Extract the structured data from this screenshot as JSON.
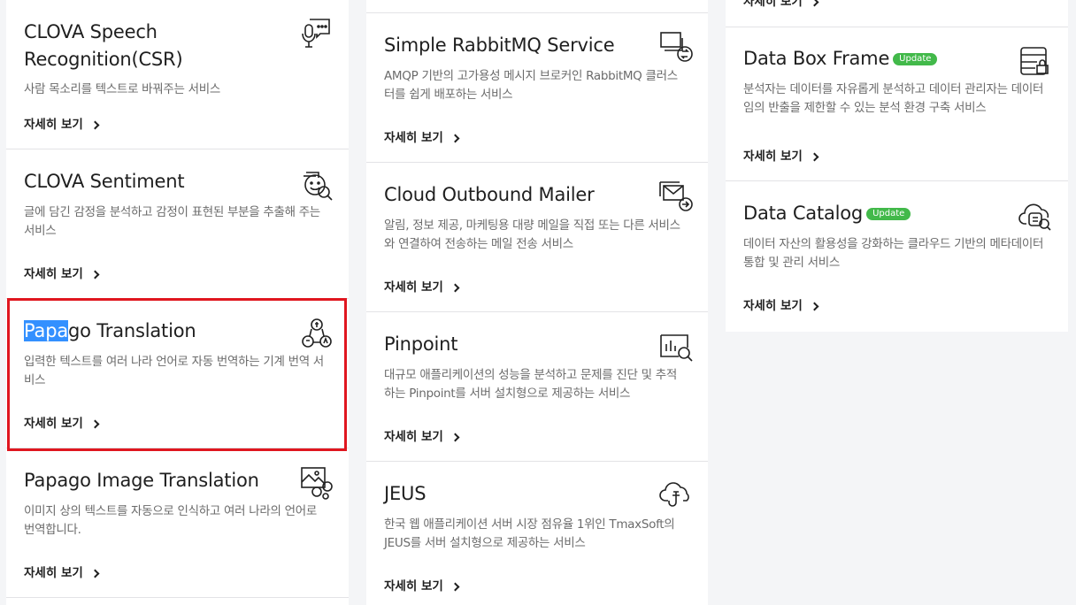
{
  "more_label": "자세히 보기",
  "badge_label": "Update",
  "col1": [
    {
      "title_lines": [
        "CLOVA Speech",
        "Recognition(CSR)"
      ],
      "desc": "사람 목소리를 텍스트로 바꿔주는 서비스",
      "icon": "speech-bubble-mic-icon"
    },
    {
      "title": "CLOVA Sentiment",
      "desc": "글에 담긴 감정을 분석하고 감정이 표현된 부분을 추출해 주는 서비스",
      "icon": "sentiment-face-search-icon"
    },
    {
      "title_highlight": "Papa",
      "title_rest": "go Translation",
      "desc": "입력한 텍스트를 여러 나라 언어로 자동 번역하는 기계 번역 서비스",
      "icon": "translation-nodes-icon"
    },
    {
      "title": "Papago Image Translation",
      "desc": "이미지 상의 텍스트를 자동으로 인식하고 여러 나라의 언어로 번역합니다.",
      "icon": "image-translation-icon"
    }
  ],
  "col2": [
    {
      "title": "Simple RabbitMQ Service",
      "desc": "AMQP 기반의 고가용성 메시지 브로커인 RabbitMQ 클러스터를 쉽게 배포하는 서비스",
      "icon": "message-queue-icon"
    },
    {
      "title": "Cloud Outbound Mailer",
      "desc": "알림, 정보 제공, 마케팅용 대량 메일을 직접 또는 다른 서비스와 연결하여 전송하는 메일 전송 서비스",
      "icon": "mail-send-icon"
    },
    {
      "title": "Pinpoint",
      "desc": "대규모 애플리케이션의 성능을 분석하고 문제를 진단 및 추적하는 Pinpoint를 서버 설치형으로 제공하는 서비스",
      "icon": "chart-search-icon"
    },
    {
      "title": "JEUS",
      "desc": "한국 웹 애플리케이션 서버 시장 점유율 1위인 TmaxSoft의 JEUS를 서버 설치형으로 제공하는 서비스",
      "icon": "cloud-plug-icon"
    }
  ],
  "col3": [
    {
      "title": "Data Box Frame",
      "desc": "분석자는 데이터를 자유롭게 분석하고 데이터 관리자는 데이터 임의 반출을 제한할 수 있는 분석 환경 구축 서비스",
      "icon": "data-box-lock-icon"
    },
    {
      "title": "Data Catalog",
      "desc": "데이터 자산의 활용성을 강화하는 클라우드 기반의 메타데이터 통합 및 관리 서비스",
      "icon": "cloud-catalog-icon"
    }
  ]
}
